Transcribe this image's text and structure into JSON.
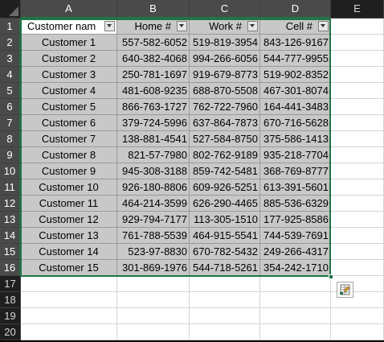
{
  "columns": [
    "A",
    "B",
    "C",
    "D",
    "E"
  ],
  "row_numbers": [
    "1",
    "2",
    "3",
    "4",
    "5",
    "6",
    "7",
    "8",
    "9",
    "10",
    "11",
    "12",
    "13",
    "14",
    "15",
    "16",
    "17",
    "18",
    "19",
    "20"
  ],
  "header_row": [
    "Customer nam",
    "Home #",
    "Work #",
    "Cell #"
  ],
  "rows": [
    [
      "Customer 1",
      "557-582-6052",
      "519-819-3954",
      "843-126-9167"
    ],
    [
      "Customer 2",
      "640-382-4068",
      "994-266-6056",
      "544-777-9955"
    ],
    [
      "Customer 3",
      "250-781-1697",
      "919-679-8773",
      "519-902-8352"
    ],
    [
      "Customer 4",
      "481-608-9235",
      "688-870-5508",
      "467-301-8074"
    ],
    [
      "Customer 5",
      "866-763-1727",
      "762-722-7960",
      "164-441-3483"
    ],
    [
      "Customer 6",
      "379-724-5996",
      "637-864-7873",
      "670-716-5628"
    ],
    [
      "Customer 7",
      "138-881-4541",
      "527-584-8750",
      "375-586-1413"
    ],
    [
      "Customer 8",
      "821-57-7980",
      "802-762-9189",
      "935-218-7704"
    ],
    [
      "Customer 9",
      "945-308-3188",
      "859-742-5481",
      "368-769-8777"
    ],
    [
      "Customer 10",
      "926-180-8806",
      "609-926-5251",
      "613-391-5601"
    ],
    [
      "Customer 11",
      "464-214-3599",
      "626-290-4465",
      "885-536-6329"
    ],
    [
      "Customer 12",
      "929-794-7177",
      "113-305-1510",
      "177-925-8586"
    ],
    [
      "Customer 13",
      "761-788-5539",
      "464-915-5541",
      "744-539-7691"
    ],
    [
      "Customer 14",
      "523-97-8830",
      "670-782-5432",
      "249-266-4317"
    ],
    [
      "Customer 15",
      "301-869-1976",
      "544-718-5261",
      "354-242-1710"
    ]
  ],
  "colors": {
    "selection": "#217346",
    "selected_fill": "#c8c8c8",
    "header_bg": "#1f1f1f",
    "header_selected_bg": "#4a4a4a"
  },
  "icons": {
    "filter": "filter-dropdown-icon",
    "quick_analysis": "quick-analysis-icon",
    "select_all": "select-all-icon"
  }
}
